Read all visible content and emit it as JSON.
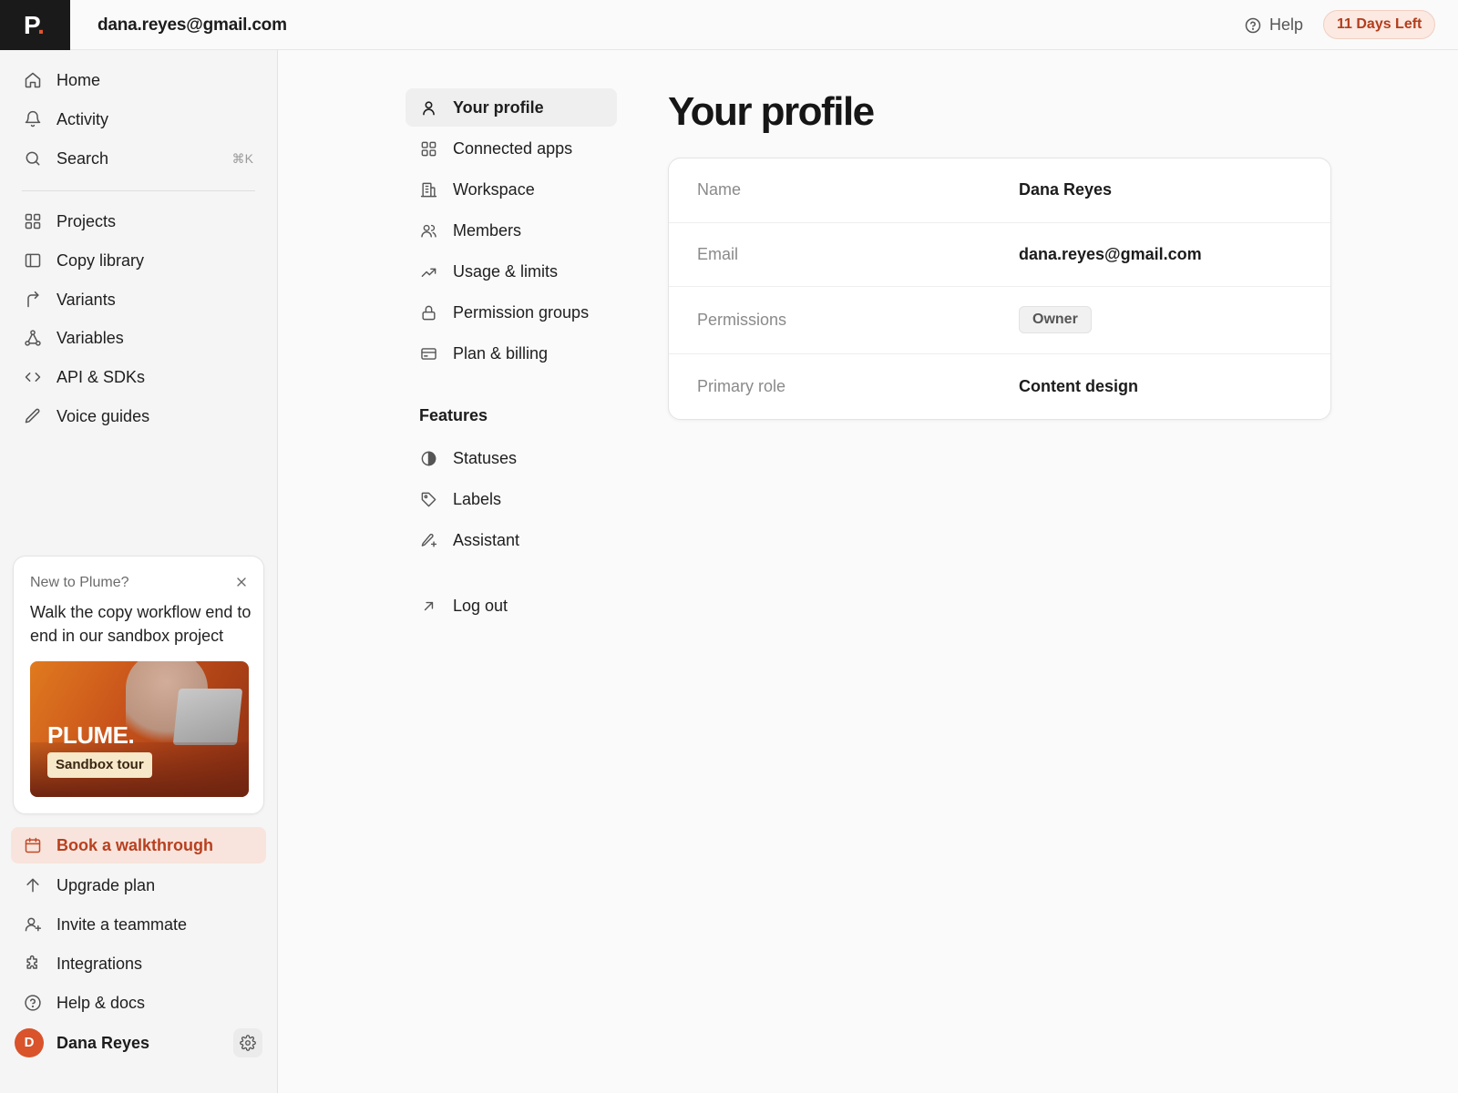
{
  "brand": {
    "logo_letter": "P",
    "logo_dot": "."
  },
  "topbar": {
    "account_email": "dana.reyes@gmail.com",
    "help_label": "Help",
    "trial_badge": "11 Days Left"
  },
  "sidebar": {
    "primary": [
      {
        "label": "Home",
        "icon": "home-icon"
      },
      {
        "label": "Activity",
        "icon": "bell-icon"
      },
      {
        "label": "Search",
        "icon": "search-icon",
        "shortcut": "⌘K"
      }
    ],
    "workspace": [
      {
        "label": "Projects",
        "icon": "grid-icon"
      },
      {
        "label": "Copy library",
        "icon": "book-icon"
      },
      {
        "label": "Variants",
        "icon": "branch-arrow-icon"
      },
      {
        "label": "Variables",
        "icon": "nodes-icon"
      },
      {
        "label": "API & SDKs",
        "icon": "code-icon"
      },
      {
        "label": "Voice guides",
        "icon": "pen-icon"
      }
    ],
    "promo": {
      "kicker": "New to Plume?",
      "body": "Walk the copy workflow end to end in our sandbox project",
      "media_brand": "PLUME.",
      "media_chip": "Sandbox tour"
    },
    "footer": [
      {
        "label": "Book a walkthrough",
        "icon": "calendar-icon",
        "accent": true
      },
      {
        "label": "Upgrade plan",
        "icon": "arrow-up-icon"
      },
      {
        "label": "Invite a teammate",
        "icon": "user-plus-icon"
      },
      {
        "label": "Integrations",
        "icon": "puzzle-icon"
      },
      {
        "label": "Help & docs",
        "icon": "help-circle-icon"
      }
    ],
    "user": {
      "initial": "D",
      "name": "Dana Reyes"
    }
  },
  "settings_nav": {
    "items": [
      {
        "label": "Your profile",
        "icon": "user-icon",
        "active": true
      },
      {
        "label": "Connected apps",
        "icon": "apps-icon"
      },
      {
        "label": "Workspace",
        "icon": "building-icon"
      },
      {
        "label": "Members",
        "icon": "users-icon"
      },
      {
        "label": "Usage & limits",
        "icon": "trend-icon"
      },
      {
        "label": "Permission groups",
        "icon": "lock-icon"
      },
      {
        "label": "Plan & billing",
        "icon": "card-icon"
      }
    ],
    "features_heading": "Features",
    "features": [
      {
        "label": "Statuses",
        "icon": "half-circle-icon"
      },
      {
        "label": "Labels",
        "icon": "tag-icon"
      },
      {
        "label": "Assistant",
        "icon": "sparkle-pen-icon"
      }
    ],
    "logout": {
      "label": "Log out",
      "icon": "arrow-up-right-icon"
    }
  },
  "profile": {
    "title": "Your profile",
    "fields": {
      "name": {
        "label": "Name",
        "value": "Dana Reyes"
      },
      "email": {
        "label": "Email",
        "value": "dana.reyes@gmail.com"
      },
      "permissions": {
        "label": "Permissions",
        "value": "Owner"
      },
      "role": {
        "label": "Primary role",
        "value": "Content design"
      }
    }
  }
}
